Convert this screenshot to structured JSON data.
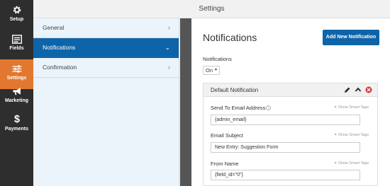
{
  "app": {
    "title": "Settings"
  },
  "sidebar": {
    "items": [
      {
        "label": "Setup",
        "icon": "gear-icon"
      },
      {
        "label": "Fields",
        "icon": "fields-icon"
      },
      {
        "label": "Settings",
        "icon": "sliders-icon",
        "active": true
      },
      {
        "label": "Marketing",
        "icon": "megaphone-icon"
      },
      {
        "label": "Payments",
        "icon": "dollar-icon"
      }
    ]
  },
  "sections": {
    "items": [
      {
        "label": "General"
      },
      {
        "label": "Notifications",
        "active": true
      },
      {
        "label": "Confirmation"
      }
    ]
  },
  "main": {
    "title": "Notifications",
    "add_button": "Add New Notification",
    "notifications_label": "Notifications",
    "toggle_value": "On",
    "panel": {
      "title": "Default Notification",
      "smart_tags": "Show Smart Tags",
      "fields": [
        {
          "label": "Send To Email Address",
          "value": "{admin_email}"
        },
        {
          "label": "Email Subject",
          "value": "New Entry: Suggestion Form"
        },
        {
          "label": "From Name",
          "value": "{field_id=\"0\"}"
        }
      ]
    }
  },
  "colors": {
    "sidebar_bg": "#2e2e2e",
    "sidebar_active": "#e27730",
    "accent_blue": "#0e64a8",
    "section_bg": "#ebf3fb",
    "delete_red": "#d63638"
  }
}
